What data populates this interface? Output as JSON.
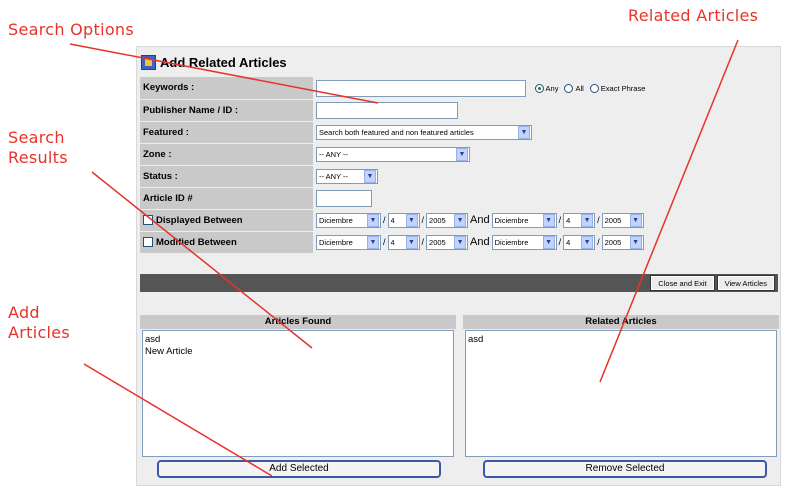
{
  "callouts": {
    "search_options": "Search Options",
    "related_articles": "Related Articles",
    "search_results": "Search\nResults",
    "add_articles": "Add\nArticles"
  },
  "panel": {
    "title": "Add Related Articles",
    "icon": "articles-icon"
  },
  "form": {
    "keywords": {
      "label": "Keywords :",
      "value": ""
    },
    "match_options": [
      {
        "label": "Any",
        "selected": true
      },
      {
        "label": "All",
        "selected": false
      },
      {
        "label": "Exact Phrase",
        "selected": false
      }
    ],
    "publisher": {
      "label": "Publisher Name / ID :",
      "value": ""
    },
    "featured": {
      "label": "Featured :",
      "value": "Search both featured and non featured articles"
    },
    "zone": {
      "label": "Zone :",
      "value": "-- ANY --"
    },
    "status": {
      "label": "Status :",
      "value": "-- ANY --"
    },
    "article_id": {
      "label": "Article ID #",
      "value": ""
    },
    "displayed": {
      "label": "Displayed Between",
      "checked": false,
      "from": {
        "month": "Diciembre",
        "day": "4",
        "year": "2005"
      },
      "and": "And",
      "to": {
        "month": "Diciembre",
        "day": "4",
        "year": "2005"
      }
    },
    "modified": {
      "label": "Modified Between",
      "checked": false,
      "from": {
        "month": "Diciembre",
        "day": "4",
        "year": "2005"
      },
      "and": "And",
      "to": {
        "month": "Diciembre",
        "day": "4",
        "year": "2005"
      }
    },
    "date_sep": "/",
    "dropdown_arrow": "▼"
  },
  "actions": {
    "close_exit": "Close and Exit",
    "view_articles": "View Articles"
  },
  "articles_found": {
    "header": "Articles Found",
    "items": [
      "asd",
      "New Article"
    ],
    "button": "Add Selected"
  },
  "related_articles": {
    "header": "Related Articles",
    "items": [
      "asd"
    ],
    "button": "Remove Selected"
  },
  "colors": {
    "callout": "#e8322a",
    "label_bg": "#c9c9c9",
    "panel_bg": "#eeeeee",
    "action_bar": "#555555",
    "button_border": "#3a57a8"
  }
}
